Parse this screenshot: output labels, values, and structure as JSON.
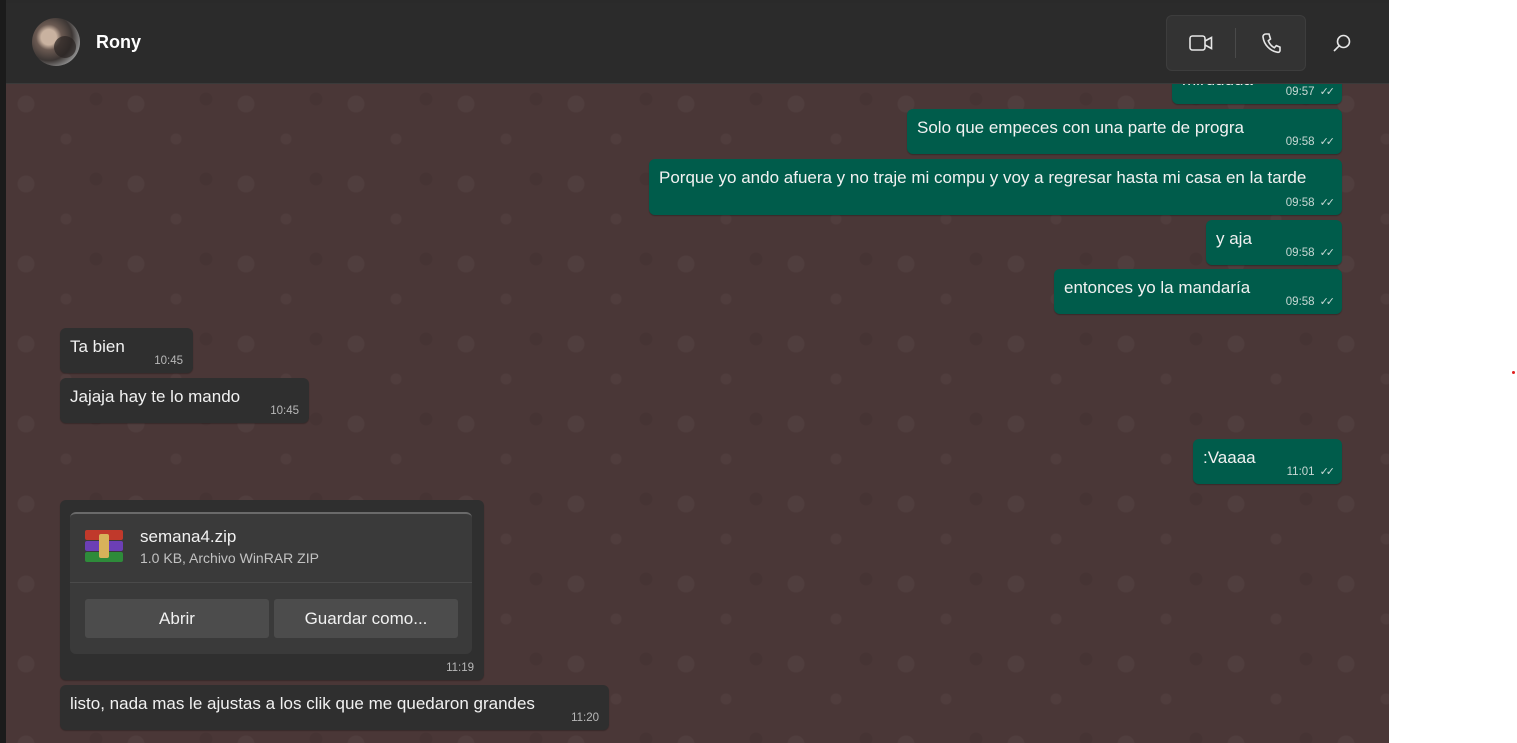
{
  "header": {
    "contact_name": "Rony",
    "video_call_icon": "video-camera-icon",
    "voice_call_icon": "phone-icon",
    "search_icon": "search-icon"
  },
  "messages": [
    {
      "direction": "out",
      "text": "mirdddda",
      "time": "09:57",
      "status": "read"
    },
    {
      "direction": "out",
      "text": "Solo que empeces con una parte de progra",
      "time": "09:58",
      "status": "read"
    },
    {
      "direction": "out",
      "text": "Porque yo ando afuera y no traje mi compu y voy a regresar hasta mi casa en la tarde",
      "time": "09:58",
      "status": "read"
    },
    {
      "direction": "out",
      "text": "y aja",
      "time": "09:58",
      "status": "read"
    },
    {
      "direction": "out",
      "text": "entonces yo la mandaría",
      "time": "09:58",
      "status": "read"
    },
    {
      "direction": "in",
      "text": "Ta bien",
      "time": "10:45"
    },
    {
      "direction": "in",
      "text": "Jajaja hay te lo mando",
      "time": "10:45"
    },
    {
      "direction": "out",
      "text": ":Vaaaa",
      "time": "11:01",
      "status": "read"
    },
    {
      "direction": "in",
      "type": "file",
      "time": "11:19",
      "file": {
        "name": "semana4.zip",
        "info": "1.0 KB, Archivo WinRAR ZIP",
        "icon": "winrar-archive-icon",
        "open_label": "Abrir",
        "save_label": "Guardar como..."
      }
    },
    {
      "direction": "in",
      "text": "listo, nada mas le ajustas a los clik que me quedaron grandes",
      "time": "11:20"
    }
  ],
  "colors": {
    "outgoing_bubble": "#005c4b",
    "incoming_bubble": "#2f2f2f",
    "chat_background": "#4a3737",
    "header_background": "#2b2b2b"
  }
}
